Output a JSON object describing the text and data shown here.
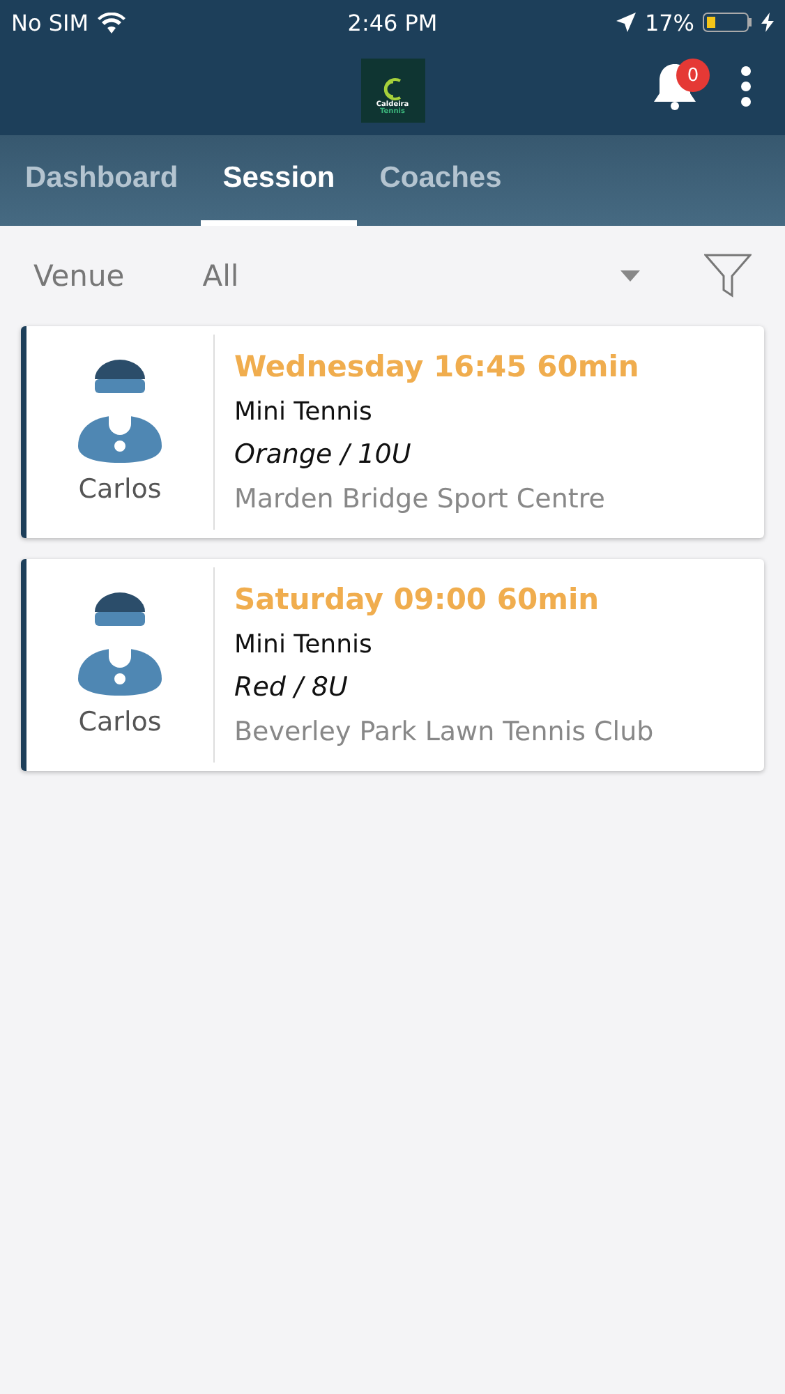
{
  "status_bar": {
    "carrier": "No SIM",
    "time": "2:46 PM",
    "battery": "17%"
  },
  "header": {
    "logo": {
      "line1": "Caldeira",
      "line2": "Tennis"
    },
    "notifications": "0"
  },
  "tabs": [
    {
      "label": "Dashboard",
      "selected": false
    },
    {
      "label": "Session",
      "selected": true
    },
    {
      "label": "Coaches",
      "selected": false
    }
  ],
  "filter": {
    "label": "Venue",
    "value": "All"
  },
  "sessions": [
    {
      "coach": "Carlos",
      "when": "Wednesday 16:45 60min",
      "activity": "Mini Tennis",
      "group": "Orange / 10U",
      "venue": "Marden Bridge Sport Centre"
    },
    {
      "coach": "Carlos",
      "when": "Saturday 09:00 60min",
      "activity": "Mini Tennis",
      "group": "Red / 8U",
      "venue": "Beverley Park Lawn Tennis Club"
    }
  ]
}
